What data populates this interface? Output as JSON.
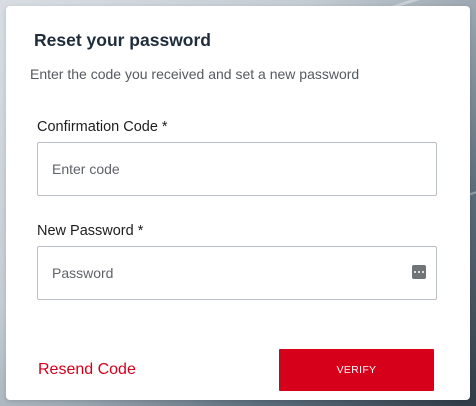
{
  "dialog": {
    "title": "Reset your password",
    "subtitle": "Enter the code you received and set a new password"
  },
  "form": {
    "code": {
      "label": "Confirmation Code *",
      "placeholder": "Enter code",
      "value": ""
    },
    "password": {
      "label": "New Password *",
      "placeholder": "Password",
      "value": "",
      "icon": "password-dots-icon"
    }
  },
  "actions": {
    "resend_label": "Resend Code",
    "verify_label": "VERIFY"
  },
  "colors": {
    "accent": "#d7001a",
    "link": "#d0021b",
    "title": "#1f2c3a"
  }
}
